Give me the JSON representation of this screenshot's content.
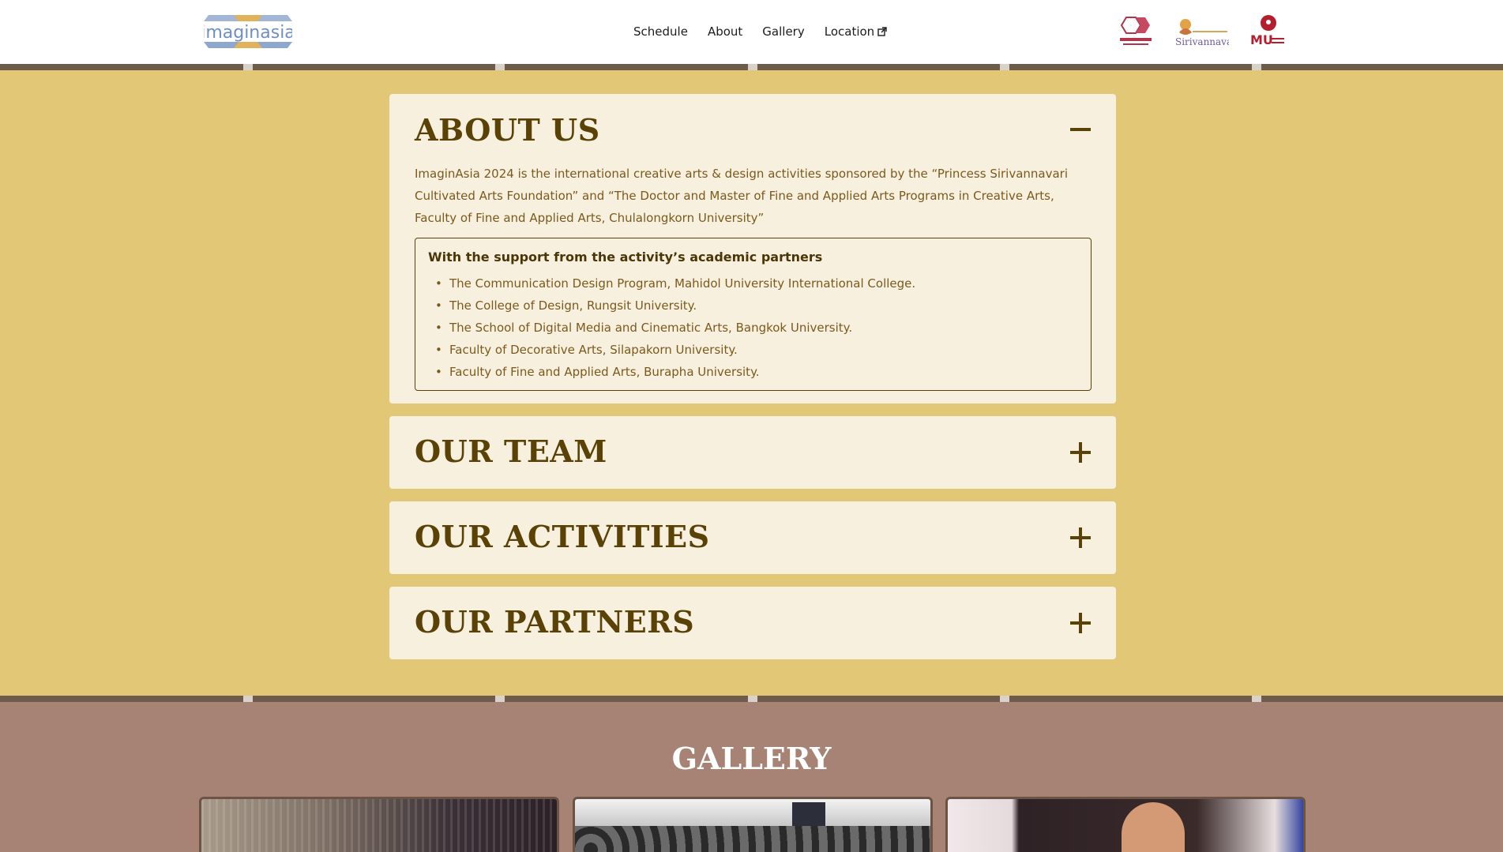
{
  "header": {
    "logo_label": "imaginasia",
    "nav": [
      {
        "label": "Schedule"
      },
      {
        "label": "About"
      },
      {
        "label": "Gallery"
      },
      {
        "label": "Location",
        "icon": "external-link-icon"
      }
    ],
    "partner_logos": [
      {
        "name": "fine-arts-faculty-logo"
      },
      {
        "name": "sirivannavari-logo",
        "label": "Sirivannavari"
      },
      {
        "name": "mu-logo",
        "label": "MU"
      }
    ]
  },
  "about": {
    "title": "ABOUT US",
    "expanded": true,
    "description": "ImaginAsia 2024 is the international creative arts & design activities sponsored by the “Princess Sirivannavari Cultivated Arts Foundation” and “The Doctor and Master of Fine and Applied Arts Programs in Creative Arts, Faculty of Fine and Applied Arts, Chulalongkorn University”",
    "support_title": "With the support from the activity’s academic partners",
    "partners": [
      "The Communication Design Program, Mahidol University International College.",
      "The College of Design, Rungsit University.",
      "The School of Digital Media and Cinematic Arts, Bangkok University.",
      "Faculty of Decorative Arts, Silapakorn University.",
      "Faculty of Fine and Applied Arts, Burapha University."
    ]
  },
  "sections": [
    {
      "title": "OUR TEAM",
      "expanded": false
    },
    {
      "title": "OUR ACTIVITIES",
      "expanded": false
    },
    {
      "title": "OUR PARTNERS",
      "expanded": false
    }
  ],
  "gallery": {
    "title": "GALLERY"
  },
  "colors": {
    "page_bg": "#e2c776",
    "panel_bg": "#f8f0de",
    "heading": "#5a4206",
    "body_text": "#7a5a1c",
    "stripe": "#6e5b4b",
    "gallery_bg": "#a78375"
  }
}
